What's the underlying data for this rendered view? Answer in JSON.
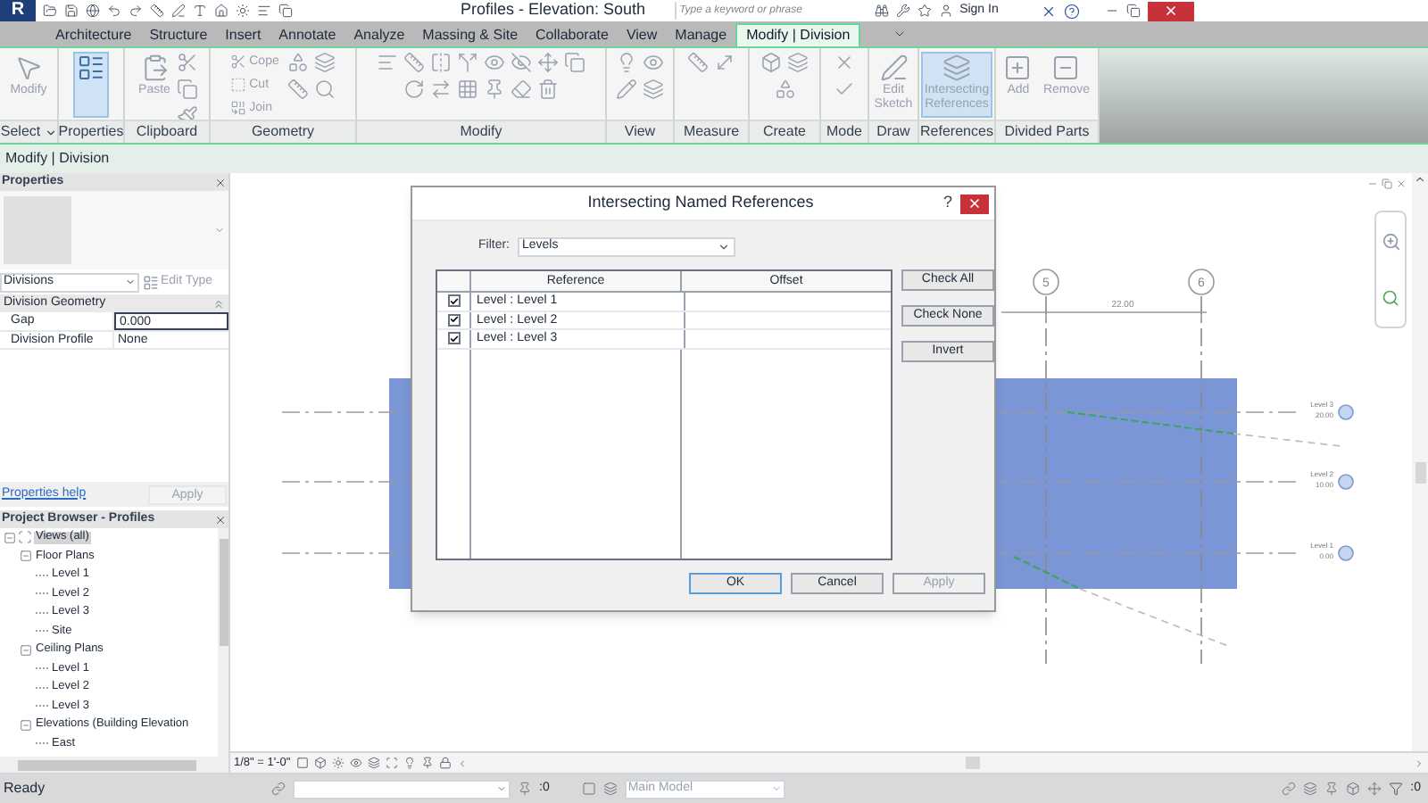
{
  "title_bar": {
    "app_menu": "R",
    "title": "Profiles - Elevation: South",
    "search": {
      "placeholder": "Type a keyword or phrase"
    },
    "sign_in": "Sign In"
  },
  "ribbon_tabs": [
    {
      "label": "Architecture",
      "selected": false
    },
    {
      "label": "Structure",
      "selected": false
    },
    {
      "label": "Insert",
      "selected": false
    },
    {
      "label": "Annotate",
      "selected": false
    },
    {
      "label": "Analyze",
      "selected": false
    },
    {
      "label": "Massing & Site",
      "selected": false
    },
    {
      "label": "Collaborate",
      "selected": false
    },
    {
      "label": "View",
      "selected": false
    },
    {
      "label": "Manage",
      "selected": false
    },
    {
      "label": "Modify | Division",
      "selected": true
    }
  ],
  "ribbon_panels": [
    {
      "label": "Select",
      "dropdown": true,
      "buttons": [
        {
          "kind": "large",
          "label": "Modify",
          "disabled": true,
          "selected": false
        }
      ]
    },
    {
      "label": "Properties",
      "buttons": [
        {
          "kind": "large",
          "disabled": false,
          "selected": true
        }
      ]
    },
    {
      "label": "Clipboard",
      "buttons": [
        {
          "kind": "large",
          "label": "Paste",
          "disabled": true,
          "selected": false
        }
      ]
    },
    {
      "label": "Geometry",
      "buttons": [
        {
          "kind": "small",
          "label": "Cope",
          "disabled": true,
          "selected": false
        },
        {
          "kind": "small",
          "label": "Cut",
          "disabled": true,
          "selected": false
        },
        {
          "kind": "small",
          "label": "Join",
          "disabled": true,
          "selected": false
        }
      ]
    },
    {
      "label": "Modify"
    },
    {
      "label": "View"
    },
    {
      "label": "Measure"
    },
    {
      "label": "Create"
    },
    {
      "label": "Mode"
    },
    {
      "label": "Draw",
      "buttons": [
        {
          "kind": "large",
          "label": "Edit Sketch",
          "disabled": true,
          "selected": false
        }
      ]
    },
    {
      "label": "References",
      "buttons": [
        {
          "kind": "large",
          "label": "Intersecting References",
          "disabled": true,
          "selected": true
        }
      ]
    },
    {
      "label": "Divided Parts",
      "buttons": [
        {
          "kind": "large",
          "label": "Add",
          "disabled": true,
          "selected": false
        },
        {
          "kind": "large",
          "label": "Remove",
          "disabled": true,
          "selected": false
        }
      ]
    }
  ],
  "context_bar": "Modify | Division",
  "properties": {
    "title": "Properties",
    "type_selector": "Divisions",
    "edit_type": {
      "label": "Edit Type",
      "disabled": true
    },
    "group": {
      "label": "Division Geometry",
      "expanded": true
    },
    "rows": [
      {
        "name": "Gap",
        "value": "0.000",
        "selected": true
      },
      {
        "name": "Division Profile",
        "value": "None",
        "selected": false
      }
    ],
    "help_link": "Properties help",
    "apply": {
      "label": "Apply",
      "disabled": true
    }
  },
  "project_browser": {
    "title": "Project Browser - Profiles",
    "tree": [
      {
        "label": "Views (all)",
        "selected": true,
        "expanded": true,
        "children": [
          {
            "label": "Floor Plans",
            "selected": false,
            "expanded": true,
            "children": [
              {
                "label": "Level 1",
                "selected": false
              },
              {
                "label": "Level 2",
                "selected": false
              },
              {
                "label": "Level 3",
                "selected": false
              },
              {
                "label": "Site",
                "selected": false
              }
            ]
          },
          {
            "label": "Ceiling Plans",
            "selected": false,
            "expanded": true,
            "children": [
              {
                "label": "Level 1",
                "selected": false
              },
              {
                "label": "Level 2",
                "selected": false
              },
              {
                "label": "Level 3",
                "selected": false
              }
            ]
          },
          {
            "label": "Elevations (Building Elevation",
            "selected": false,
            "expanded": true,
            "children": [
              {
                "label": "East",
                "selected": false
              }
            ]
          }
        ]
      }
    ]
  },
  "view": {
    "grids": [
      {
        "label": "5"
      },
      {
        "label": "6"
      }
    ],
    "dimension": "22.00",
    "levels": [
      {
        "name": "Level 3",
        "elevation": "20.00"
      },
      {
        "name": "Level 2",
        "elevation": "10.00"
      },
      {
        "name": "Level 1",
        "elevation": "0.00"
      }
    ],
    "scale": "1/8\" = 1'-0\""
  },
  "dialog": {
    "title": "Intersecting Named References",
    "help": "?",
    "filter": {
      "label": "Filter:",
      "value": "Levels"
    },
    "columns": [
      "Reference",
      "Offset"
    ],
    "rows": [
      {
        "reference": "Level : Level 1",
        "checked": true
      },
      {
        "reference": "Level : Level 2",
        "checked": true
      },
      {
        "reference": "Level : Level 3",
        "checked": true
      }
    ],
    "side_buttons": [
      "Check All",
      "Check None",
      "Invert"
    ],
    "footer_buttons": [
      {
        "label": "OK",
        "default": true,
        "disabled": false
      },
      {
        "label": "Cancel",
        "default": false,
        "disabled": false
      },
      {
        "label": "Apply",
        "default": false,
        "disabled": true
      }
    ]
  },
  "status_bar": {
    "message": "Ready",
    "editable_count": ":0",
    "design_option": "Main Model",
    "filter_count": ":0"
  }
}
